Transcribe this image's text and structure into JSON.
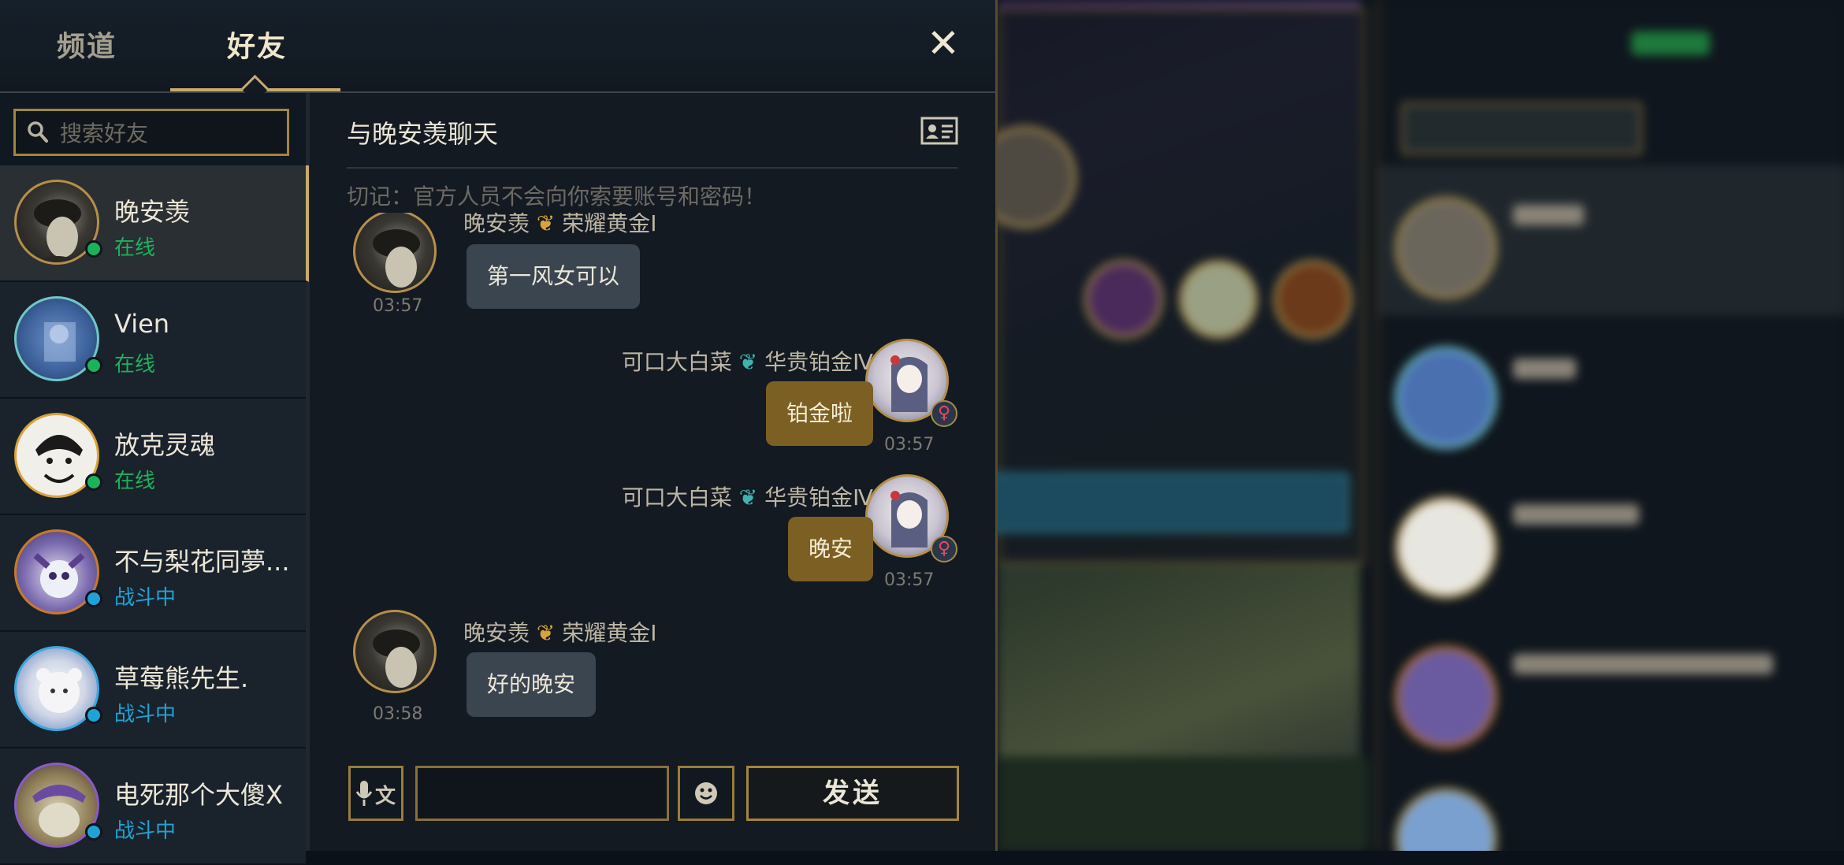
{
  "tabs": {
    "channel": "频道",
    "friends": "好友"
  },
  "close": "✕",
  "search": {
    "placeholder": "搜索好友"
  },
  "friends": [
    {
      "name": "晚安羡",
      "status": "在线",
      "status_color": "#1bb35a"
    },
    {
      "name": "Vien",
      "status": "在线",
      "status_color": "#1bb35a"
    },
    {
      "name": "放克灵魂",
      "status": "在线",
      "status_color": "#1bb35a"
    },
    {
      "name": "不与梨花同夢...",
      "status": "战斗中",
      "status_color": "#1fa3d6"
    },
    {
      "name": "草莓熊先生.",
      "status": "战斗中",
      "status_color": "#1fa3d6"
    },
    {
      "name": "电死那个大傻X",
      "status": "战斗中",
      "status_color": "#1fa3d6"
    }
  ],
  "chat": {
    "title": "与晚安羡聊天",
    "warning": "切记：官方人员不会向你索要账号和密码！",
    "messages": [
      {
        "side": "in",
        "sender": "晚安羡",
        "rank": "荣耀黄金Ⅰ",
        "text": "第一风女可以",
        "time": "03:57"
      },
      {
        "side": "out",
        "sender": "可口大白菜",
        "rank": "华贵铂金Ⅳ",
        "text": "铂金啦",
        "time": "03:57"
      },
      {
        "side": "out",
        "sender": "可口大白菜",
        "rank": "华贵铂金Ⅳ",
        "text": "晚安",
        "time": "03:57"
      },
      {
        "side": "in",
        "sender": "晚安羡",
        "rank": "荣耀黄金Ⅰ",
        "text": "好的晚安",
        "time": "03:58"
      }
    ]
  },
  "composer": {
    "voice_label": "文",
    "send_label": "发送",
    "message_value": ""
  },
  "colors": {
    "gold": "#c8aa6e",
    "online": "#1bb35a",
    "in_game": "#1fa3d6",
    "out_bubble": "#7c5f22",
    "in_bubble": "#3a4550"
  }
}
